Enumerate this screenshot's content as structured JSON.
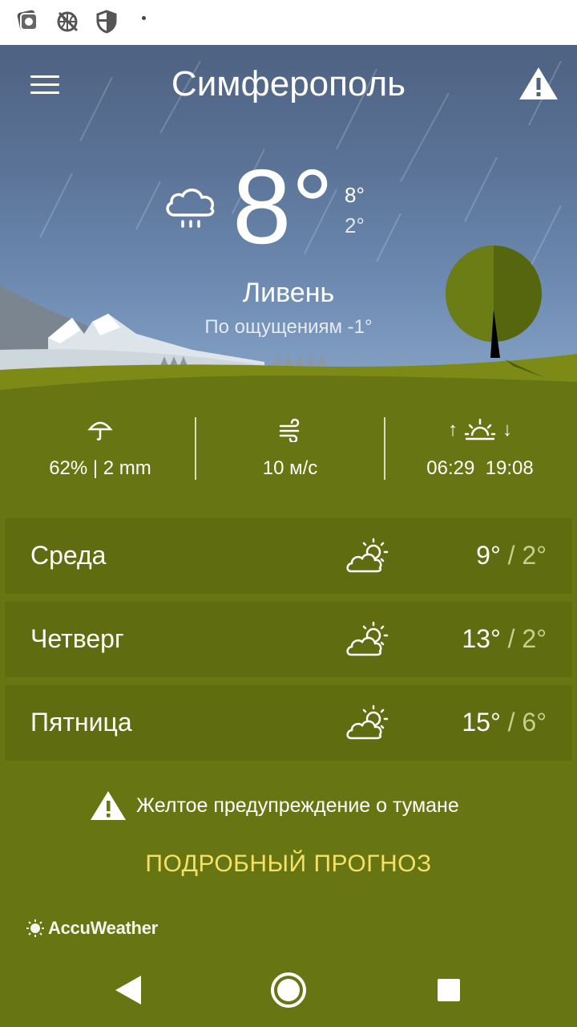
{
  "app": {
    "city": "Симферополь",
    "current": {
      "temperature": "8°",
      "high": "8°",
      "low": "2°",
      "condition": "Ливень",
      "feels_like": "По ощущениям -1°",
      "icon": "cloud-rain-icon"
    },
    "details": {
      "precipitation": "62% | 2 mm",
      "wind": "10 м/с",
      "sunrise": "06:29",
      "sunset": "19:08"
    },
    "forecast": [
      {
        "day": "Среда",
        "high": "9°",
        "low": "2°",
        "icon": "partly-cloudy-icon"
      },
      {
        "day": "Четверг",
        "high": "13°",
        "low": "2°",
        "icon": "partly-cloudy-icon"
      },
      {
        "day": "Пятница",
        "high": "15°",
        "low": "6°",
        "icon": "partly-cloudy-icon"
      }
    ],
    "separator": "/",
    "warning": "Желтое предупреждение о тумане",
    "detailed_forecast_label": "ПОДРОБНЫЙ ПРОГНОЗ",
    "brand": "AccuWeather"
  },
  "colors": {
    "grass": "#677612",
    "row_bg": "#5f6d10",
    "link": "#f4e167",
    "sky_top": "#4e6282",
    "sky_bottom": "#88a5c8"
  }
}
